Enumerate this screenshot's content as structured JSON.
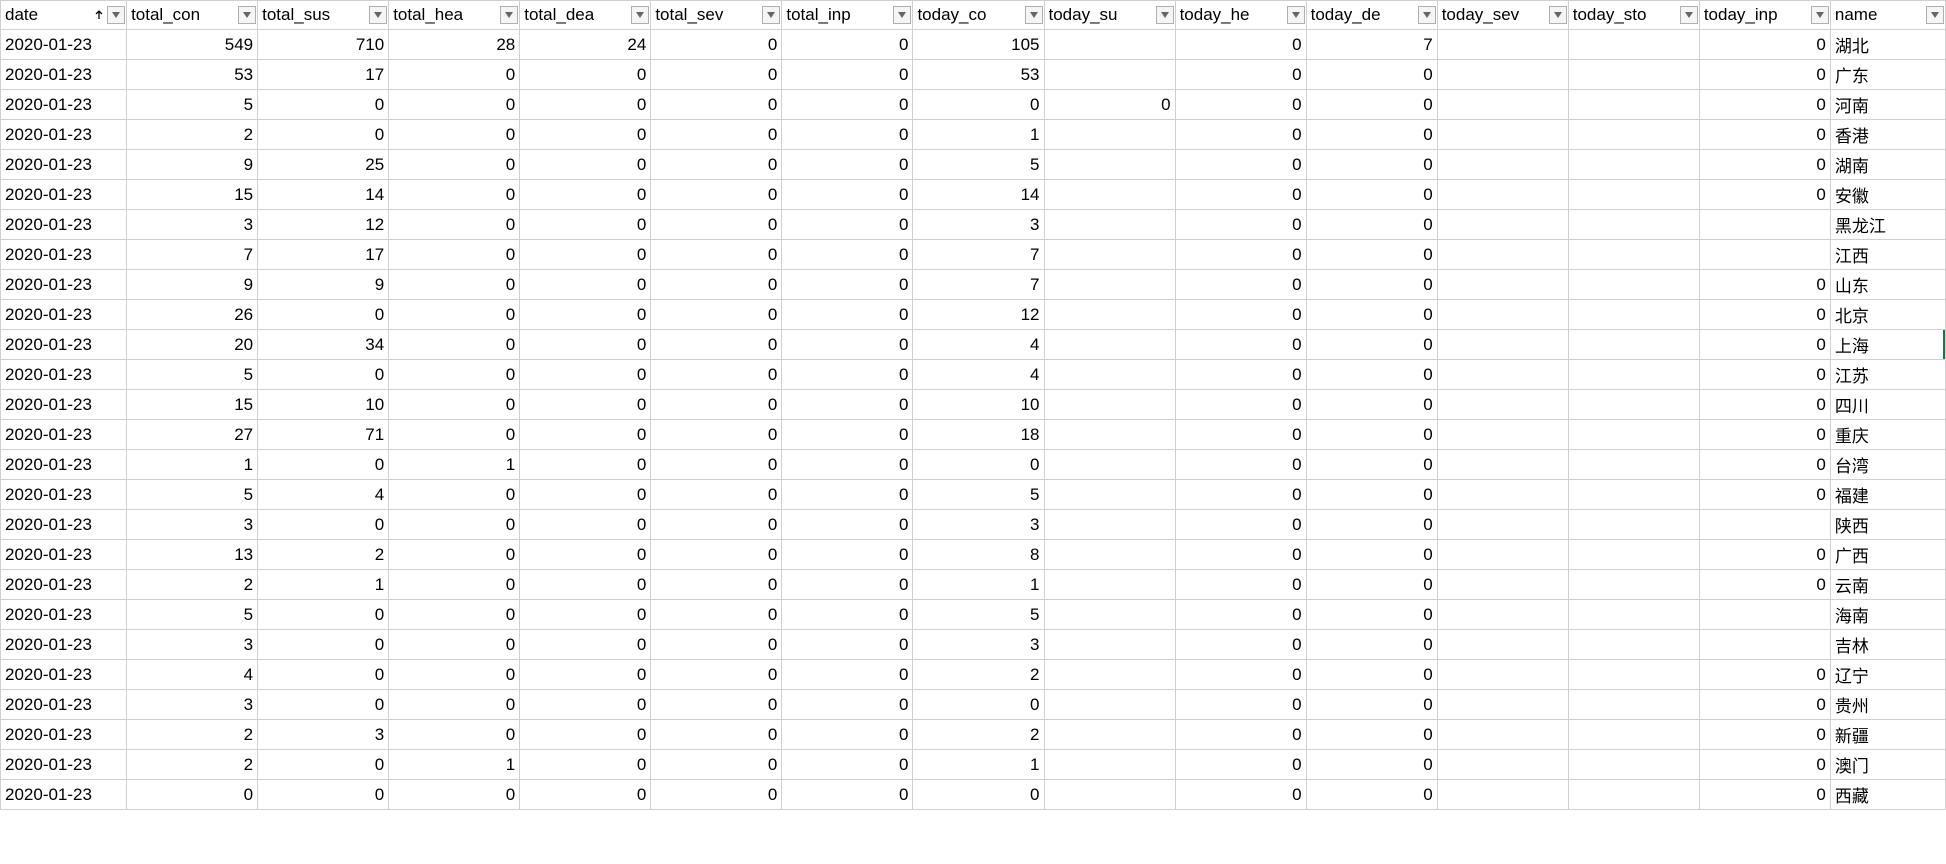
{
  "columns": [
    {
      "key": "date",
      "label": "date",
      "align": "txt",
      "cls": "col-date",
      "sorted": true
    },
    {
      "key": "total_con",
      "label": "total_con",
      "align": "num",
      "cls": "col-num"
    },
    {
      "key": "total_sus",
      "label": "total_sus",
      "align": "num",
      "cls": "col-num"
    },
    {
      "key": "total_hea",
      "label": "total_hea",
      "align": "num",
      "cls": "col-num"
    },
    {
      "key": "total_dea",
      "label": "total_dea",
      "align": "num",
      "cls": "col-num"
    },
    {
      "key": "total_sev",
      "label": "total_sev",
      "align": "num",
      "cls": "col-num"
    },
    {
      "key": "total_inp",
      "label": "total_inp",
      "align": "num",
      "cls": "col-num"
    },
    {
      "key": "today_con",
      "label": "today_co",
      "align": "num",
      "cls": "col-num"
    },
    {
      "key": "today_sus",
      "label": "today_su",
      "align": "num",
      "cls": "col-num"
    },
    {
      "key": "today_hea",
      "label": "today_he",
      "align": "num",
      "cls": "col-num"
    },
    {
      "key": "today_dea",
      "label": "today_de",
      "align": "num",
      "cls": "col-num"
    },
    {
      "key": "today_sev",
      "label": "today_sev",
      "align": "num",
      "cls": "col-num"
    },
    {
      "key": "today_sto",
      "label": "today_sto",
      "align": "num",
      "cls": "col-num"
    },
    {
      "key": "today_inp",
      "label": "today_inp",
      "align": "num",
      "cls": "col-num"
    },
    {
      "key": "name",
      "label": "name",
      "align": "txt",
      "cls": "col-name"
    }
  ],
  "rows": [
    {
      "date": "2020-01-23",
      "total_con": "549",
      "total_sus": "710",
      "total_hea": "28",
      "total_dea": "24",
      "total_sev": "0",
      "total_inp": "0",
      "today_con": "105",
      "today_sus": "",
      "today_hea": "0",
      "today_dea": "7",
      "today_sev": "",
      "today_sto": "",
      "today_inp": "0",
      "name": "湖北"
    },
    {
      "date": "2020-01-23",
      "total_con": "53",
      "total_sus": "17",
      "total_hea": "0",
      "total_dea": "0",
      "total_sev": "0",
      "total_inp": "0",
      "today_con": "53",
      "today_sus": "",
      "today_hea": "0",
      "today_dea": "0",
      "today_sev": "",
      "today_sto": "",
      "today_inp": "0",
      "name": "广东"
    },
    {
      "date": "2020-01-23",
      "total_con": "5",
      "total_sus": "0",
      "total_hea": "0",
      "total_dea": "0",
      "total_sev": "0",
      "total_inp": "0",
      "today_con": "0",
      "today_sus": "0",
      "today_hea": "0",
      "today_dea": "0",
      "today_sev": "",
      "today_sto": "",
      "today_inp": "0",
      "name": "河南"
    },
    {
      "date": "2020-01-23",
      "total_con": "2",
      "total_sus": "0",
      "total_hea": "0",
      "total_dea": "0",
      "total_sev": "0",
      "total_inp": "0",
      "today_con": "1",
      "today_sus": "",
      "today_hea": "0",
      "today_dea": "0",
      "today_sev": "",
      "today_sto": "",
      "today_inp": "0",
      "name": "香港"
    },
    {
      "date": "2020-01-23",
      "total_con": "9",
      "total_sus": "25",
      "total_hea": "0",
      "total_dea": "0",
      "total_sev": "0",
      "total_inp": "0",
      "today_con": "5",
      "today_sus": "",
      "today_hea": "0",
      "today_dea": "0",
      "today_sev": "",
      "today_sto": "",
      "today_inp": "0",
      "name": "湖南"
    },
    {
      "date": "2020-01-23",
      "total_con": "15",
      "total_sus": "14",
      "total_hea": "0",
      "total_dea": "0",
      "total_sev": "0",
      "total_inp": "0",
      "today_con": "14",
      "today_sus": "",
      "today_hea": "0",
      "today_dea": "0",
      "today_sev": "",
      "today_sto": "",
      "today_inp": "0",
      "name": "安徽"
    },
    {
      "date": "2020-01-23",
      "total_con": "3",
      "total_sus": "12",
      "total_hea": "0",
      "total_dea": "0",
      "total_sev": "0",
      "total_inp": "0",
      "today_con": "3",
      "today_sus": "",
      "today_hea": "0",
      "today_dea": "0",
      "today_sev": "",
      "today_sto": "",
      "today_inp": "",
      "name": "黑龙江"
    },
    {
      "date": "2020-01-23",
      "total_con": "7",
      "total_sus": "17",
      "total_hea": "0",
      "total_dea": "0",
      "total_sev": "0",
      "total_inp": "0",
      "today_con": "7",
      "today_sus": "",
      "today_hea": "0",
      "today_dea": "0",
      "today_sev": "",
      "today_sto": "",
      "today_inp": "",
      "name": "江西"
    },
    {
      "date": "2020-01-23",
      "total_con": "9",
      "total_sus": "9",
      "total_hea": "0",
      "total_dea": "0",
      "total_sev": "0",
      "total_inp": "0",
      "today_con": "7",
      "today_sus": "",
      "today_hea": "0",
      "today_dea": "0",
      "today_sev": "",
      "today_sto": "",
      "today_inp": "0",
      "name": "山东"
    },
    {
      "date": "2020-01-23",
      "total_con": "26",
      "total_sus": "0",
      "total_hea": "0",
      "total_dea": "0",
      "total_sev": "0",
      "total_inp": "0",
      "today_con": "12",
      "today_sus": "",
      "today_hea": "0",
      "today_dea": "0",
      "today_sev": "",
      "today_sto": "",
      "today_inp": "0",
      "name": "北京"
    },
    {
      "date": "2020-01-23",
      "total_con": "20",
      "total_sus": "34",
      "total_hea": "0",
      "total_dea": "0",
      "total_sev": "0",
      "total_inp": "0",
      "today_con": "4",
      "today_sus": "",
      "today_hea": "0",
      "today_dea": "0",
      "today_sev": "",
      "today_sto": "",
      "today_inp": "0",
      "name": "上海",
      "selected": true
    },
    {
      "date": "2020-01-23",
      "total_con": "5",
      "total_sus": "0",
      "total_hea": "0",
      "total_dea": "0",
      "total_sev": "0",
      "total_inp": "0",
      "today_con": "4",
      "today_sus": "",
      "today_hea": "0",
      "today_dea": "0",
      "today_sev": "",
      "today_sto": "",
      "today_inp": "0",
      "name": "江苏"
    },
    {
      "date": "2020-01-23",
      "total_con": "15",
      "total_sus": "10",
      "total_hea": "0",
      "total_dea": "0",
      "total_sev": "0",
      "total_inp": "0",
      "today_con": "10",
      "today_sus": "",
      "today_hea": "0",
      "today_dea": "0",
      "today_sev": "",
      "today_sto": "",
      "today_inp": "0",
      "name": "四川"
    },
    {
      "date": "2020-01-23",
      "total_con": "27",
      "total_sus": "71",
      "total_hea": "0",
      "total_dea": "0",
      "total_sev": "0",
      "total_inp": "0",
      "today_con": "18",
      "today_sus": "",
      "today_hea": "0",
      "today_dea": "0",
      "today_sev": "",
      "today_sto": "",
      "today_inp": "0",
      "name": "重庆"
    },
    {
      "date": "2020-01-23",
      "total_con": "1",
      "total_sus": "0",
      "total_hea": "1",
      "total_dea": "0",
      "total_sev": "0",
      "total_inp": "0",
      "today_con": "0",
      "today_sus": "",
      "today_hea": "0",
      "today_dea": "0",
      "today_sev": "",
      "today_sto": "",
      "today_inp": "0",
      "name": "台湾"
    },
    {
      "date": "2020-01-23",
      "total_con": "5",
      "total_sus": "4",
      "total_hea": "0",
      "total_dea": "0",
      "total_sev": "0",
      "total_inp": "0",
      "today_con": "5",
      "today_sus": "",
      "today_hea": "0",
      "today_dea": "0",
      "today_sev": "",
      "today_sto": "",
      "today_inp": "0",
      "name": "福建"
    },
    {
      "date": "2020-01-23",
      "total_con": "3",
      "total_sus": "0",
      "total_hea": "0",
      "total_dea": "0",
      "total_sev": "0",
      "total_inp": "0",
      "today_con": "3",
      "today_sus": "",
      "today_hea": "0",
      "today_dea": "0",
      "today_sev": "",
      "today_sto": "",
      "today_inp": "",
      "name": "陕西"
    },
    {
      "date": "2020-01-23",
      "total_con": "13",
      "total_sus": "2",
      "total_hea": "0",
      "total_dea": "0",
      "total_sev": "0",
      "total_inp": "0",
      "today_con": "8",
      "today_sus": "",
      "today_hea": "0",
      "today_dea": "0",
      "today_sev": "",
      "today_sto": "",
      "today_inp": "0",
      "name": "广西"
    },
    {
      "date": "2020-01-23",
      "total_con": "2",
      "total_sus": "1",
      "total_hea": "0",
      "total_dea": "0",
      "total_sev": "0",
      "total_inp": "0",
      "today_con": "1",
      "today_sus": "",
      "today_hea": "0",
      "today_dea": "0",
      "today_sev": "",
      "today_sto": "",
      "today_inp": "0",
      "name": "云南"
    },
    {
      "date": "2020-01-23",
      "total_con": "5",
      "total_sus": "0",
      "total_hea": "0",
      "total_dea": "0",
      "total_sev": "0",
      "total_inp": "0",
      "today_con": "5",
      "today_sus": "",
      "today_hea": "0",
      "today_dea": "0",
      "today_sev": "",
      "today_sto": "",
      "today_inp": "",
      "name": "海南"
    },
    {
      "date": "2020-01-23",
      "total_con": "3",
      "total_sus": "0",
      "total_hea": "0",
      "total_dea": "0",
      "total_sev": "0",
      "total_inp": "0",
      "today_con": "3",
      "today_sus": "",
      "today_hea": "0",
      "today_dea": "0",
      "today_sev": "",
      "today_sto": "",
      "today_inp": "",
      "name": "吉林"
    },
    {
      "date": "2020-01-23",
      "total_con": "4",
      "total_sus": "0",
      "total_hea": "0",
      "total_dea": "0",
      "total_sev": "0",
      "total_inp": "0",
      "today_con": "2",
      "today_sus": "",
      "today_hea": "0",
      "today_dea": "0",
      "today_sev": "",
      "today_sto": "",
      "today_inp": "0",
      "name": "辽宁"
    },
    {
      "date": "2020-01-23",
      "total_con": "3",
      "total_sus": "0",
      "total_hea": "0",
      "total_dea": "0",
      "total_sev": "0",
      "total_inp": "0",
      "today_con": "0",
      "today_sus": "",
      "today_hea": "0",
      "today_dea": "0",
      "today_sev": "",
      "today_sto": "",
      "today_inp": "0",
      "name": "贵州"
    },
    {
      "date": "2020-01-23",
      "total_con": "2",
      "total_sus": "3",
      "total_hea": "0",
      "total_dea": "0",
      "total_sev": "0",
      "total_inp": "0",
      "today_con": "2",
      "today_sus": "",
      "today_hea": "0",
      "today_dea": "0",
      "today_sev": "",
      "today_sto": "",
      "today_inp": "0",
      "name": "新疆"
    },
    {
      "date": "2020-01-23",
      "total_con": "2",
      "total_sus": "0",
      "total_hea": "1",
      "total_dea": "0",
      "total_sev": "0",
      "total_inp": "0",
      "today_con": "1",
      "today_sus": "",
      "today_hea": "0",
      "today_dea": "0",
      "today_sev": "",
      "today_sto": "",
      "today_inp": "0",
      "name": "澳门"
    },
    {
      "date": "2020-01-23",
      "total_con": "0",
      "total_sus": "0",
      "total_hea": "0",
      "total_dea": "0",
      "total_sev": "0",
      "total_inp": "0",
      "today_con": "0",
      "today_sus": "",
      "today_hea": "0",
      "today_dea": "0",
      "today_sev": "",
      "today_sto": "",
      "today_inp": "0",
      "name": "西藏"
    }
  ]
}
